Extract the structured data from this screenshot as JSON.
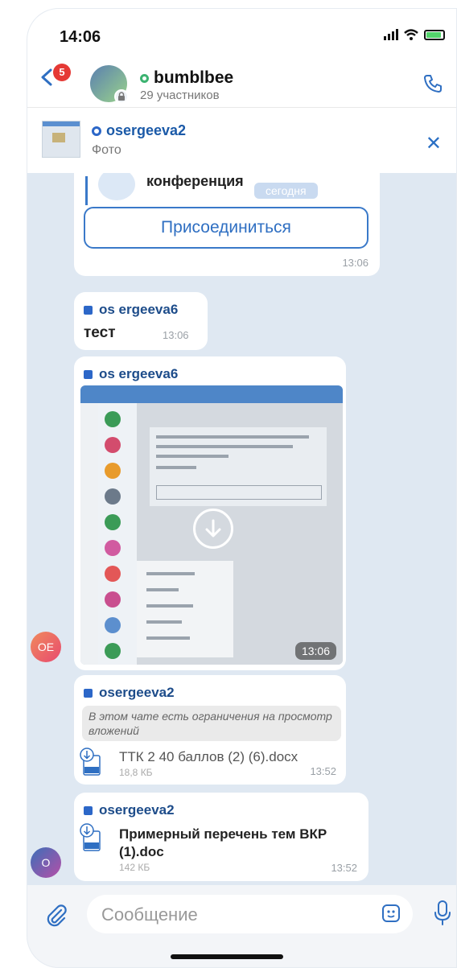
{
  "status": {
    "time": "14:06"
  },
  "header": {
    "unread_badge": "5",
    "chat_name": "bumblbee",
    "members": "29 участников"
  },
  "pinned": {
    "sender": "osergeeva2",
    "caption": "Фото"
  },
  "messages": {
    "conference": {
      "title": "конференция",
      "date_pill": "сегодня",
      "join_label": "Присоединиться",
      "time": "13:06"
    },
    "text_msg": {
      "sender": "os ergeeva6",
      "text": "тест",
      "time": "13:06"
    },
    "photo_msg": {
      "sender": "os ergeeva6",
      "time": "13:06"
    },
    "file_msg_1": {
      "sender": "osergeeva2",
      "restriction": "В этом чате есть ограничения на просмотр вложений",
      "file_name": "ТТК 2 40 баллов (2) (6).docx",
      "file_size": "18,8 КБ",
      "file_ext": "docx",
      "time": "13:52"
    },
    "file_msg_2": {
      "sender": "osergeeva2",
      "file_name_line1": "Примерный перечень тем ВКР",
      "file_name_line2": "(1).doc",
      "file_size": "142 КБ",
      "file_ext": "doc",
      "time": "13:52"
    }
  },
  "avatars": {
    "oe": "OE",
    "o": "O"
  },
  "composer": {
    "placeholder": "Сообщение"
  },
  "colors": {
    "accent": "#2f6fc2",
    "badge": "#e53935",
    "chat_bg": "#dfe8f2"
  }
}
